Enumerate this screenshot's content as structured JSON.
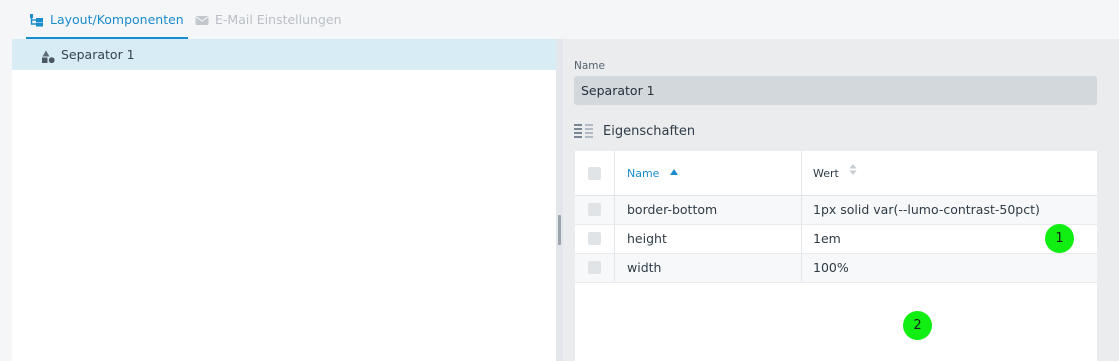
{
  "tabs": [
    {
      "label": "Layout/Komponenten",
      "active": true,
      "icon": "tree-structure-icon"
    },
    {
      "label": "E-Mail Einstellungen",
      "active": false,
      "icon": "envelope-icon"
    }
  ],
  "tree": {
    "items": [
      {
        "label": "Separator 1",
        "icon": "shapes-icon",
        "selected": true
      }
    ]
  },
  "details": {
    "name_label": "Name",
    "name_value": "Separator 1",
    "section_title": "Eigenschaften",
    "section_icon": "properties-list-icon"
  },
  "grid": {
    "columns": [
      {
        "label": "Name",
        "sort": "ascending"
      },
      {
        "label": "Wert",
        "sort": "none"
      }
    ],
    "rows": [
      {
        "name": "border-bottom",
        "value": "1px solid var(--lumo-contrast-50pct)"
      },
      {
        "name": "height",
        "value": "1em"
      },
      {
        "name": "width",
        "value": "100%"
      }
    ]
  },
  "markers": [
    {
      "label": "1"
    },
    {
      "label": "2"
    }
  ],
  "colors": {
    "accent": "#1a8ccc",
    "selection": "#d8ecf5",
    "marker": "#11ee11"
  }
}
